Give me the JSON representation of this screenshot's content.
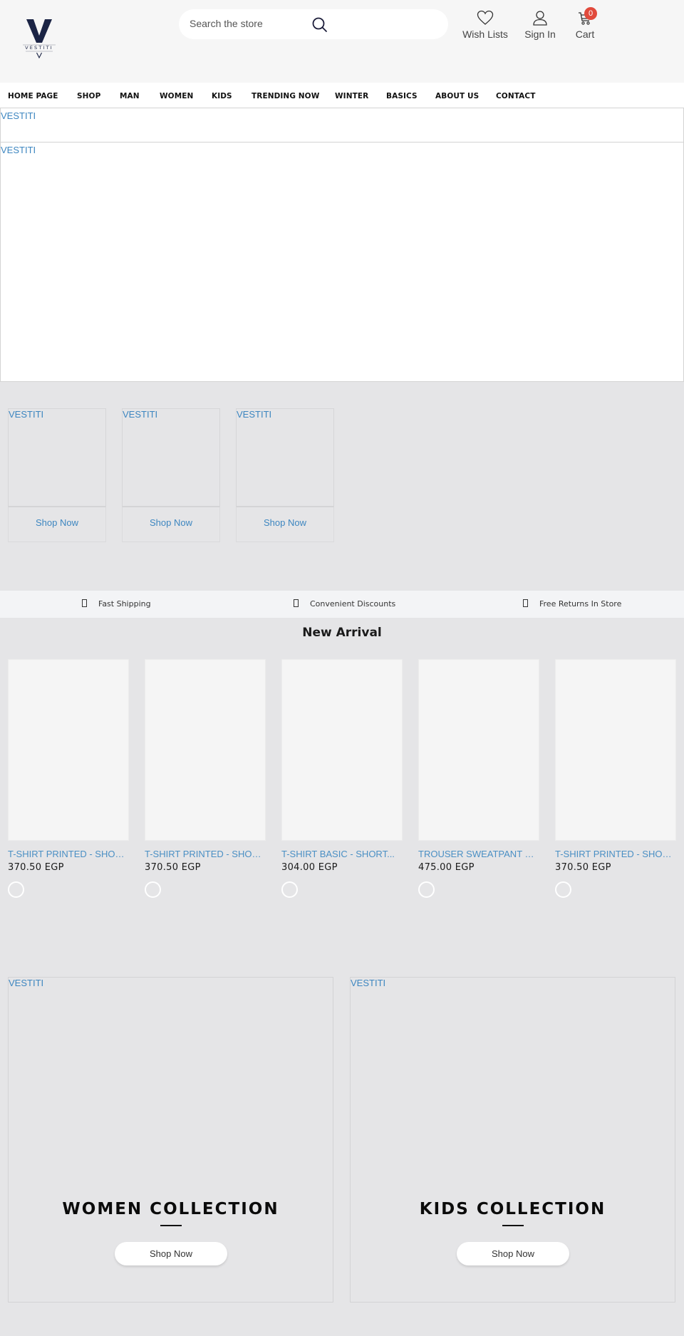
{
  "header": {
    "logo_text": "VESTITI",
    "logo_icon": "vestiti-logo",
    "search": {
      "placeholder": "Search the store",
      "icon": "search-icon"
    },
    "actions": [
      {
        "label": "Wish Lists",
        "icon": "heart-icon"
      },
      {
        "label": "Sign In",
        "icon": "user-icon"
      },
      {
        "label": "Cart",
        "icon": "cart-icon",
        "badge": "0"
      }
    ],
    "colors": {
      "badge": "#e14a3c",
      "icon": "#1c1d3a"
    }
  },
  "nav": {
    "items": [
      {
        "label": "HOME PAGE"
      },
      {
        "label": "SHOP"
      },
      {
        "label": "MAN"
      },
      {
        "label": "WOMEN"
      },
      {
        "label": "KIDS"
      },
      {
        "label": "TRENDING NOW"
      },
      {
        "label": "WINTER"
      },
      {
        "label": "BASICS"
      },
      {
        "label": "ABOUT US"
      },
      {
        "label": "CONTACT"
      }
    ]
  },
  "hero": {
    "banners": [
      {
        "alt": "VESTITI"
      },
      {
        "alt": "VESTITI"
      }
    ]
  },
  "categories": [
    {
      "alt": "VESTITI",
      "button": "Shop Now"
    },
    {
      "alt": "VESTITI",
      "button": "Shop Now"
    },
    {
      "alt": "VESTITI",
      "button": "Shop Now"
    }
  ],
  "benefits": [
    {
      "label": "Fast Shipping",
      "icon": "shipping-icon"
    },
    {
      "label": "Convenient Discounts",
      "icon": "discount-icon"
    },
    {
      "label": "Free Returns In Store",
      "icon": "returns-icon"
    }
  ],
  "new_arrival": {
    "title": "New Arrival",
    "products": [
      {
        "name": "T-SHIRT PRINTED - SHORT...",
        "price": "370.50 EGP"
      },
      {
        "name": "T-SHIRT PRINTED - SHORT...",
        "price": "370.50 EGP"
      },
      {
        "name": "T-SHIRT BASIC - SHORT...",
        "price": "304.00 EGP"
      },
      {
        "name": "TROUSER SWEATPANT SID...",
        "price": "475.00 EGP"
      },
      {
        "name": "T-SHIRT PRINTED - SHORT...",
        "price": "370.50 EGP"
      }
    ]
  },
  "collections": [
    {
      "alt": "VESTITI",
      "title": "WOMEN COLLECTION",
      "button": "Shop Now"
    },
    {
      "alt": "VESTITI",
      "title": "KIDS COLLECTION",
      "button": "Shop Now"
    }
  ],
  "colors": {
    "link": "#3d86c0",
    "page_bg": "#e5e5e7",
    "header_bg": "#f6f6f6"
  }
}
